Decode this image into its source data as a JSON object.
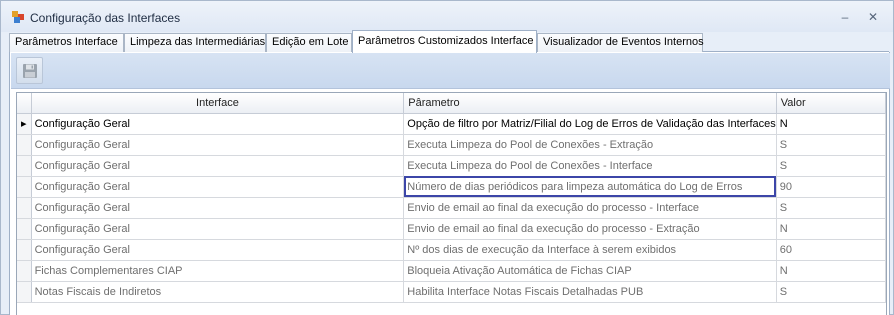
{
  "window": {
    "title": "Configuração das Interfaces",
    "minimize_glyph": "–",
    "close_glyph": "✕"
  },
  "tabs": [
    {
      "label": "Parâmetros Interface"
    },
    {
      "label": "Limpeza das Intermediárias"
    },
    {
      "label": "Edição em Lote"
    },
    {
      "label": "Parâmetros Customizados Interface",
      "active": true
    },
    {
      "label": "Visualizador de Eventos Internos"
    }
  ],
  "toolbar": {
    "save_icon": "floppy-disk-icon"
  },
  "grid": {
    "columns": [
      "Interface",
      "Pârametro",
      "Valor"
    ],
    "current_row_marker": "▸",
    "rows": [
      {
        "interface": "Configuração Geral",
        "parametro": "Opção de filtro por Matriz/Filial do Log de Erros de Validação das Interfaces",
        "valor": "N"
      },
      {
        "interface": "Configuração Geral",
        "parametro": "Executa Limpeza do Pool de Conexões - Extração",
        "valor": "S"
      },
      {
        "interface": "Configuração Geral",
        "parametro": "Executa Limpeza do Pool de Conexões - Interface",
        "valor": "S"
      },
      {
        "interface": "Configuração Geral",
        "parametro": "Número de dias periódicos para limpeza automática do Log de Erros",
        "valor": "90"
      },
      {
        "interface": "Configuração Geral",
        "parametro": "Envio de email ao final da execução do processo - Interface",
        "valor": "S"
      },
      {
        "interface": "Configuração Geral",
        "parametro": "Envio de email ao final da execução do processo - Extração",
        "valor": "N"
      },
      {
        "interface": "Configuração Geral",
        "parametro": "Nº dos dias de execução da Interface à serem exibidos",
        "valor": "60"
      },
      {
        "interface": "Fichas Complementares CIAP",
        "parametro": "Bloqueia Ativação Automática de Fichas CIAP",
        "valor": "N"
      },
      {
        "interface": "Notas Fiscais de Indiretos",
        "parametro": "Habilita Interface Notas Fiscais Detalhadas PUB",
        "valor": "S"
      }
    ]
  },
  "colors": {
    "focus_border": "#3c46a8",
    "toolbar": "#c8d8ee"
  }
}
